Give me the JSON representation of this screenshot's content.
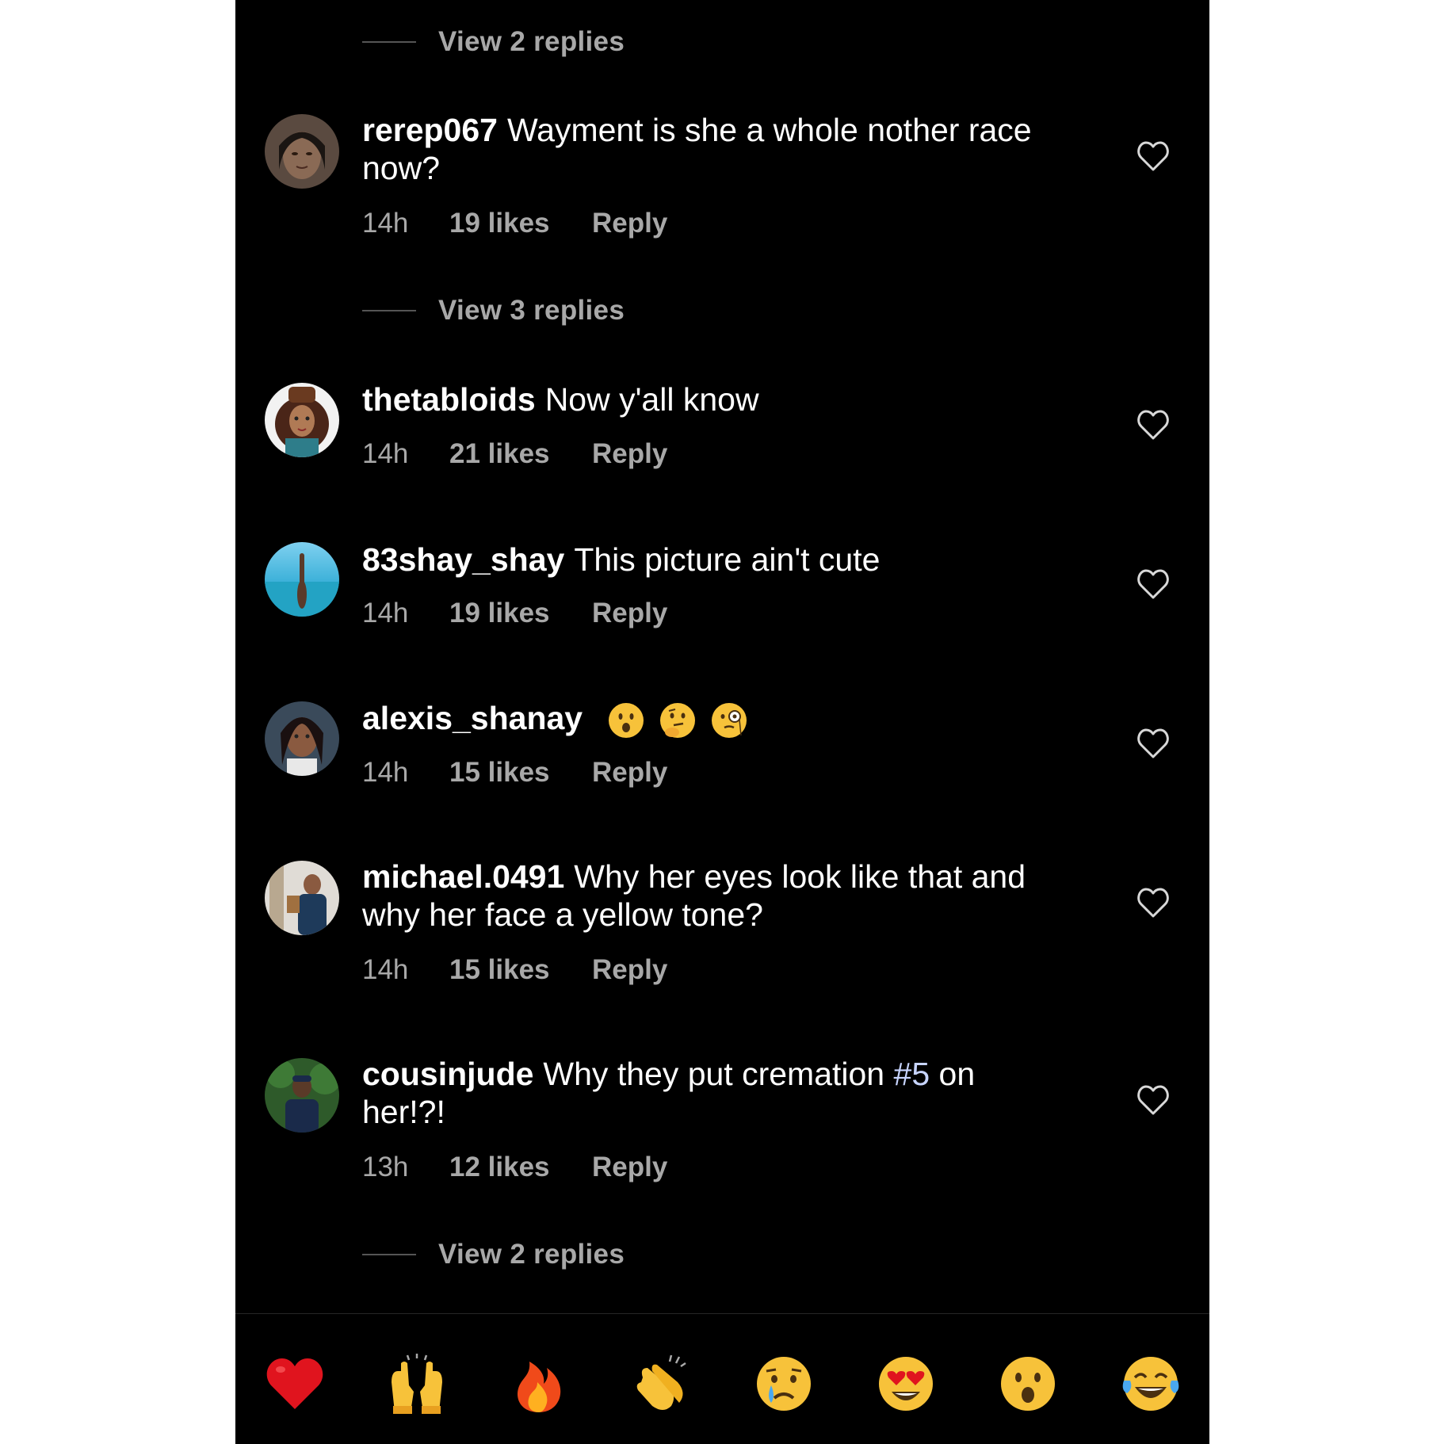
{
  "view_replies": [
    {
      "label": "View 2 replies"
    },
    {
      "label": "View 3 replies"
    },
    {
      "label": "View 2 replies"
    }
  ],
  "comments": [
    {
      "username": "rerep067",
      "text": "Wayment is she a whole nother race",
      "text_line2": "now?",
      "time": "14h",
      "likes": "19 likes",
      "reply": "Reply"
    },
    {
      "username": "thetabloids",
      "text": "Now y'all know",
      "time": "14h",
      "likes": "21 likes",
      "reply": "Reply"
    },
    {
      "username": "83shay_shay",
      "text": "This picture ain't cute",
      "time": "14h",
      "likes": "19 likes",
      "reply": "Reply"
    },
    {
      "username": "alexis_shanay",
      "emojis": [
        "hushed-face",
        "thinking-face",
        "face-with-monocle"
      ],
      "time": "14h",
      "likes": "15 likes",
      "reply": "Reply"
    },
    {
      "username": "michael.0491",
      "text": "Why her eyes look like that and",
      "text_line2": "why her face a yellow tone?",
      "time": "14h",
      "likes": "15 likes",
      "reply": "Reply"
    },
    {
      "username": "cousinjude",
      "text": "Why they put cremation",
      "hashtag": "#5",
      "text_after": "on",
      "text_line2": "her!?!",
      "time": "13h",
      "likes": "12 likes",
      "reply": "Reply"
    }
  ],
  "quick_reactions": [
    "red-heart",
    "raising-hands",
    "fire",
    "clapping-hands",
    "crying-face",
    "heart-eyes-face",
    "hushed-face",
    "tears-of-joy-face"
  ],
  "colors": {
    "background": "#000000",
    "text": "#ffffff",
    "muted": "#a8a8a8",
    "hashtag": "#c7d4ff"
  }
}
